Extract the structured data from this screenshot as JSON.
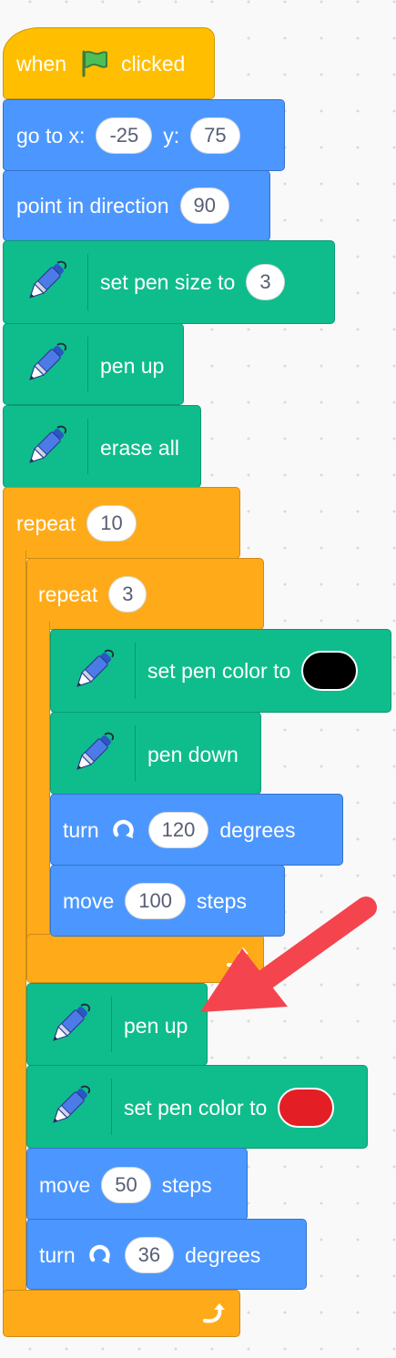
{
  "colors": {
    "motion": "#4c97ff",
    "pen": "#0fbd8c",
    "events": "#ffbf00",
    "control": "#ffab19",
    "arrow": "#f4454e"
  },
  "hat": {
    "when": "when",
    "clicked": "clicked",
    "icon": "green-flag-icon"
  },
  "goto": {
    "label_x": "go to x:",
    "x": "-25",
    "label_y": "y:",
    "y": "75"
  },
  "direction": {
    "label": "point in direction",
    "value": "90"
  },
  "pen_size": {
    "label": "set pen size to",
    "value": "3"
  },
  "pen_up_1": {
    "label": "pen up"
  },
  "erase": {
    "label": "erase all"
  },
  "repeat_outer": {
    "label": "repeat",
    "count": "10"
  },
  "repeat_inner": {
    "label": "repeat",
    "count": "3"
  },
  "pen_color_1": {
    "label": "set pen color to",
    "color": "#000000"
  },
  "pen_down": {
    "label": "pen down"
  },
  "turn_1": {
    "label": "turn",
    "value": "120",
    "unit": "degrees",
    "icon": "rotate-clockwise-icon"
  },
  "move_1": {
    "label": "move",
    "value": "100",
    "unit": "steps"
  },
  "pen_up_2": {
    "label": "pen up"
  },
  "pen_color_2": {
    "label": "set pen color to",
    "color": "#e31e24"
  },
  "move_2": {
    "label": "move",
    "value": "50",
    "unit": "steps"
  },
  "turn_2": {
    "label": "turn",
    "value": "36",
    "unit": "degrees",
    "icon": "rotate-clockwise-icon"
  },
  "loop_icon": "loop-arrow-icon"
}
